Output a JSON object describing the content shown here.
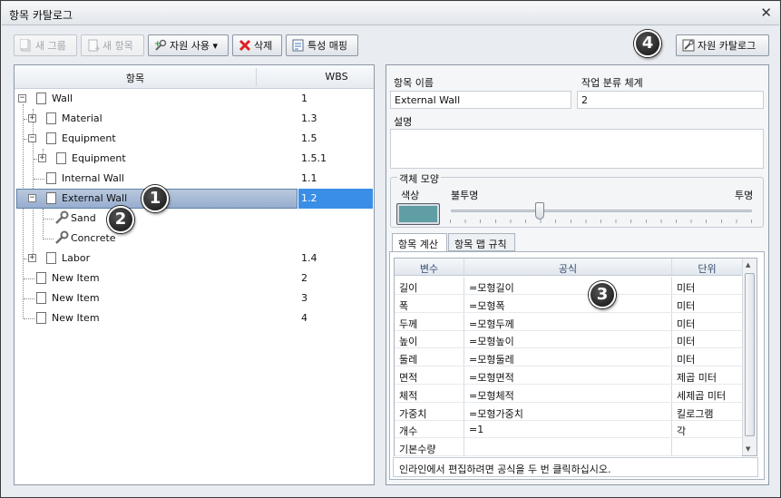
{
  "window": {
    "title": "항목 카탈로그",
    "close_glyph": "✕"
  },
  "toolbar": {
    "new_group": "새 그룹",
    "new_item": "새 항목",
    "use_resource": "자원 사용 ▾",
    "delete": "삭제",
    "map_properties": "특성 매핑",
    "resource_catalog": "자원 카탈로그"
  },
  "tree": {
    "col_item": "항목",
    "col_wbs": "WBS",
    "rows": [
      {
        "label": "Wall",
        "wbs": "1"
      },
      {
        "label": "Material",
        "wbs": "1.3"
      },
      {
        "label": "Equipment",
        "wbs": "1.5"
      },
      {
        "label": "Equipment",
        "wbs": "1.5.1"
      },
      {
        "label": "Internal Wall",
        "wbs": "1.1"
      },
      {
        "label": "External Wall",
        "wbs": "1.2"
      },
      {
        "label": "Sand",
        "wbs": ""
      },
      {
        "label": "Concrete",
        "wbs": ""
      },
      {
        "label": "Labor",
        "wbs": "1.4"
      },
      {
        "label": "New Item",
        "wbs": "2"
      },
      {
        "label": "New Item",
        "wbs": "3"
      },
      {
        "label": "New Item",
        "wbs": "4"
      }
    ]
  },
  "details": {
    "name_label": "항목 이름",
    "name_value": "External Wall",
    "wbs_label": "작업 분류 체계",
    "wbs_value": "2",
    "desc_label": "설명",
    "appearance_label": "객체 모양",
    "color_label": "색상",
    "opaque_label": "불투명",
    "transparent_label": "투명",
    "swatch_color": "#5f9ea3"
  },
  "tabs": {
    "calc": "항목 계산",
    "map_rules": "항목 맵 규칙"
  },
  "grid": {
    "col_var": "변수",
    "col_formula": "공식",
    "col_unit": "단위",
    "rows": [
      {
        "var": "길이",
        "formula": "=모형길이",
        "unit": "미터"
      },
      {
        "var": "폭",
        "formula": "=모형폭",
        "unit": "미터"
      },
      {
        "var": "두께",
        "formula": "=모형두께",
        "unit": "미터"
      },
      {
        "var": "높이",
        "formula": "=모형높이",
        "unit": "미터"
      },
      {
        "var": "둘레",
        "formula": "=모형둘레",
        "unit": "미터"
      },
      {
        "var": "면적",
        "formula": "=모형면적",
        "unit": "제곱 미터"
      },
      {
        "var": "체적",
        "formula": "=모형체적",
        "unit": "세제곱 미터"
      },
      {
        "var": "가중치",
        "formula": "=모형가중치",
        "unit": "킬로그램"
      },
      {
        "var": "개수",
        "formula": "=1",
        "unit": "각"
      },
      {
        "var": "기본수량",
        "formula": "",
        "unit": ""
      }
    ],
    "hint": "인라인에서 편집하려면 공식을 두 번 클릭하십시오."
  },
  "badges": [
    "1",
    "2",
    "3",
    "4"
  ]
}
